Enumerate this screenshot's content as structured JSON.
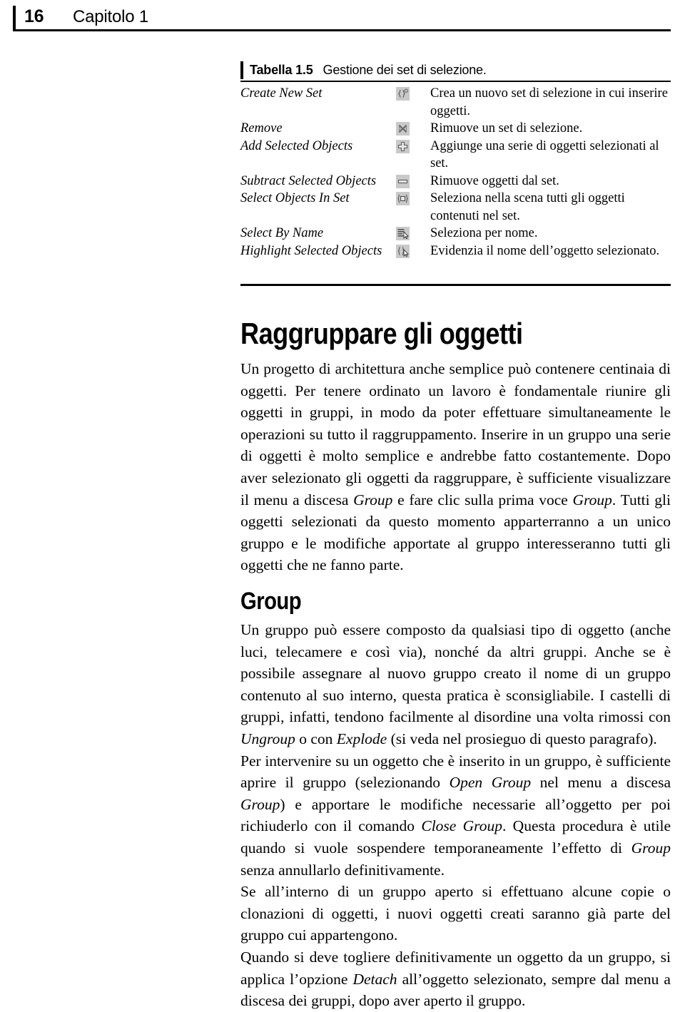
{
  "header": {
    "folio": "16",
    "title": "Capitolo 1"
  },
  "table": {
    "caption_label": "Tabella 1.5",
    "caption_desc": "Gestione dei set di selezione.",
    "rows": [
      {
        "command": "Create New Set",
        "icon": "create-new-set-icon",
        "description": "Crea un nuovo set di selezione in cui inserire oggetti."
      },
      {
        "command": "Remove",
        "icon": "remove-icon",
        "description": "Rimuove un set di selezione."
      },
      {
        "command": "Add Selected Objects",
        "icon": "plus-icon",
        "description": "Aggiunge una serie di oggetti selezionati al set."
      },
      {
        "command": "Subtract Selected Objects",
        "icon": "minus-icon",
        "description": "Rimuove oggetti dal set."
      },
      {
        "command": "Select Objects In Set",
        "icon": "select-objects-in-set-icon",
        "description": "Seleziona nella scena tutti gli oggetti contenuti nel set."
      },
      {
        "command": "Select By Name",
        "icon": "select-by-name-icon",
        "description": "Seleziona per nome."
      },
      {
        "command": "Highlight Selected Objects",
        "icon": "highlight-selected-objects-icon",
        "description": "Evidenzia il nome dell’oggetto selezionato."
      }
    ]
  },
  "sections": {
    "heading_main": "Raggruppare gli oggetti",
    "heading_sub": "Group",
    "para_1_a": "Un progetto di architettura anche semplice può contenere centinaia di oggetti. Per tenere ordinato un lavoro è fondamentale riunire gli oggetti in gruppi, in modo da poter effettuare simultaneamente le operazioni su tutto il raggruppamento. Inserire in un gruppo una serie di oggetti è molto semplice e andrebbe fatto costantemente. Dopo aver selezionato gli oggetti da raggruppare, è sufficiente visualizzare il menu a discesa ",
    "para_1_em1": "Group",
    "para_1_b": " e fare clic sulla prima voce ",
    "para_1_em2": "Group",
    "para_1_c": ". Tutti gli oggetti selezionati da questo momento apparterranno a un unico gruppo e le modifiche apportate al gruppo interesseranno tutti gli oggetti che ne fanno parte.",
    "para_2_a": "Un gruppo può essere composto da qualsiasi tipo di oggetto (anche luci, telecamere e così via), nonché da altri gruppi. Anche se è possibile assegnare al nuovo gruppo creato il nome di un gruppo contenuto al suo interno, questa pratica è sconsigliabile. I castelli di gruppi, infatti, tendono facilmente al disordine una volta rimossi con ",
    "para_2_em1": "Ungroup",
    "para_2_b": " o con ",
    "para_2_em2": "Explode",
    "para_2_c": " (si veda nel prosieguo di questo paragrafo).",
    "para_3_a": "Per intervenire su un oggetto che è inserito in un gruppo, è sufficiente aprire il gruppo (selezionando ",
    "para_3_em1": "Open Group",
    "para_3_b": " nel menu a discesa ",
    "para_3_em2": "Group",
    "para_3_c": ") e apportare le modifiche necessarie all’oggetto per poi richiuderlo con il comando ",
    "para_3_em3": "Close Group",
    "para_3_d": ". Questa procedura è utile quando si vuole sospendere temporaneamente l’effetto di ",
    "para_3_em4": "Group",
    "para_3_e": " senza annullarlo definitivamente.",
    "para_4": "Se all’interno di un gruppo aperto si effettuano alcune copie o clonazioni di oggetti, i nuovi oggetti creati saranno già parte del gruppo cui appartengono.",
    "para_5_a": "Quando si deve togliere definitivamente un oggetto da un gruppo, si applica l’opzione ",
    "para_5_em1": "Detach",
    "para_5_b": " all’oggetto selezionato, sempre dal menu a discesa dei gruppi, dopo aver aperto il gruppo."
  },
  "colors": {
    "text": "#000000",
    "icon_bg": "#c9c9c9",
    "page_bg": "#ffffff"
  }
}
